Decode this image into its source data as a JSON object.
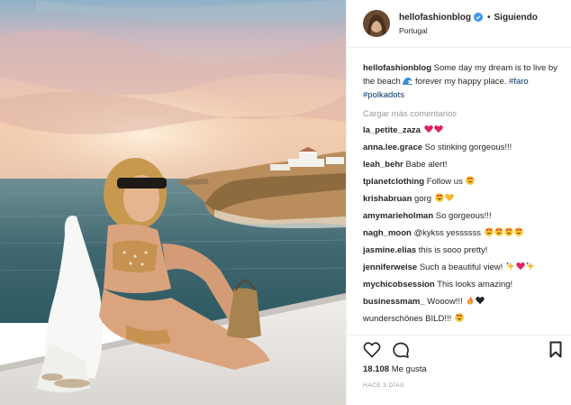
{
  "header": {
    "username": "hellofashionblog",
    "follow_status": "Siguiendo",
    "location": "Portugal",
    "separator": "•"
  },
  "caption": {
    "username": "hellofashionblog",
    "text_1": "Some day my dream is to live by the beach",
    "text_2": "forever my happy place.",
    "hashtags": [
      "#faro",
      "#polkadots"
    ]
  },
  "load_more": "Cargar más comentarios",
  "comments": [
    {
      "user": "la_petite_zaza",
      "text": "",
      "emoji": [
        "red-heart",
        "red-heart"
      ]
    },
    {
      "user": "anna.lee.grace",
      "text": "So stinking gorgeous!!!",
      "emoji": []
    },
    {
      "user": "leah_behr",
      "text": "Babe alert!",
      "emoji": []
    },
    {
      "user": "tplanetclothing",
      "text": "Follow us",
      "emoji": [
        "heart-eyes"
      ]
    },
    {
      "user": "krishabruan",
      "text": "gorg",
      "emoji": [
        "heart-eyes",
        "yellow-heart"
      ]
    },
    {
      "user": "amymarieholman",
      "text": "So gorgeous!!!",
      "emoji": []
    },
    {
      "user": "nagh_moon",
      "text": "@kykss yessssss",
      "emoji": [
        "heart-eyes",
        "heart-eyes",
        "heart-eyes",
        "heart-eyes"
      ]
    },
    {
      "user": "jasmine.elias",
      "text": "this is sooo pretty!",
      "emoji": []
    },
    {
      "user": "jenniferweise",
      "text": "Such a beautiful view!",
      "emoji": [
        "sparkles",
        "red-heart",
        "sparkles"
      ]
    },
    {
      "user": "mychicobsession",
      "text": "This looks amazing!",
      "emoji": []
    },
    {
      "user": "businessmam_",
      "text": "Wooow!!!",
      "emoji": [
        "fire",
        "black-heart"
      ]
    },
    {
      "user": "",
      "text": "wunderschönes BILD!!!",
      "emoji": [
        "heart-eyes"
      ]
    }
  ],
  "actions": {
    "icons": [
      "heart-outline-icon",
      "comment-icon",
      "bookmark-icon"
    ]
  },
  "likes": {
    "count": "18.108",
    "label": "Me gusta"
  },
  "timestamp": "HACE 3 DÍAS",
  "colors": {
    "link": "#003569",
    "verified": "#3897f0",
    "muted": "#999999",
    "text": "#262626"
  }
}
